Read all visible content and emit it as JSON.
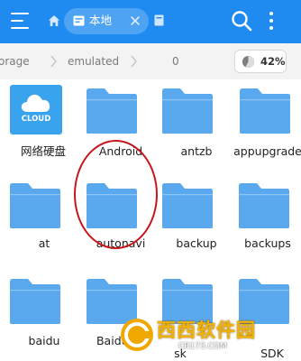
{
  "topbar": {
    "menu_icon": "hamburger-icon",
    "home_icon": "home-icon",
    "tab": {
      "label": "本地",
      "icon": "storage-icon",
      "close_icon": "close-icon"
    },
    "second_tab_icon": "folder-tab-icon",
    "search_icon": "search-icon",
    "more_icon": "more-vertical-icon",
    "colors": {
      "bar": "#1f8af0",
      "tab": "#4ea3f3"
    }
  },
  "pathbar": {
    "crumbs": [
      "orage",
      "emulated",
      "0"
    ],
    "separator_icon": "chevron-right-icon",
    "storage_usage": "42%",
    "storage_fraction": 0.42,
    "pie_icon": "pie-chart-icon"
  },
  "items": [
    {
      "label": "网络硬盘",
      "type": "cloud",
      "badge": "CLOUD"
    },
    {
      "label": "Android",
      "type": "folder",
      "highlighted": true
    },
    {
      "label": "antzb",
      "type": "folder"
    },
    {
      "label": "appupgrade",
      "type": "folder"
    },
    {
      "label": "at",
      "type": "folder"
    },
    {
      "label": "autonavi",
      "type": "folder"
    },
    {
      "label": "backup",
      "type": "folder"
    },
    {
      "label": "backups",
      "type": "folder"
    },
    {
      "label": "baidu",
      "type": "folder"
    },
    {
      "label": "BaiduMa",
      "type": "folder"
    },
    {
      "label": "sk",
      "type": "folder"
    },
    {
      "label": "SDK",
      "type": "folder"
    }
  ],
  "highlight_color": "#c8151b",
  "folder_color": "#5aa9ee",
  "watermark": {
    "name": "西西软件园",
    "url": "CR173.COM"
  }
}
